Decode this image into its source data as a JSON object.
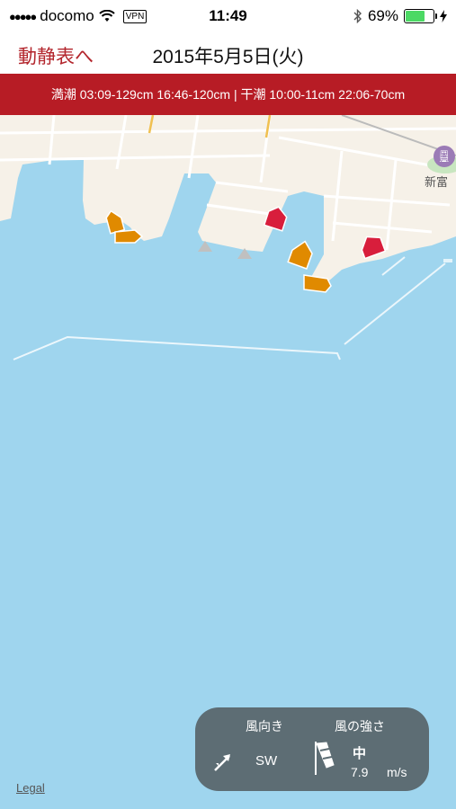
{
  "status_bar": {
    "signal_dots": "●●●●●",
    "carrier": "docomo",
    "wifi_icon": "wifi-icon",
    "vpn": "VPN",
    "time": "11:49",
    "bluetooth_icon": "bluetooth-icon",
    "battery_percent": "69%",
    "battery_level": 0.69,
    "charging_icon": "bolt-icon"
  },
  "nav": {
    "back_label": "動静表へ",
    "title": "2015年5月5日(火)"
  },
  "tide_banner": {
    "text": "満潮 03:09-129cm 16:46-120cm | 干潮 10:00-11cm 22:06-70cm"
  },
  "map": {
    "station_icon": "train-station-icon",
    "station_label": "新富",
    "legal_link": "Legal",
    "colors": {
      "water": "#9fd5ee",
      "land": "#f6f1e8",
      "ship_orange": "#e08a00",
      "ship_red": "#d81e3c"
    }
  },
  "wind": {
    "direction_header": "風向き",
    "strength_header": "風の強さ",
    "direction_icon": "wind-direction-arrow-icon",
    "direction_value": "SW",
    "windsock_icon": "windsock-icon",
    "strength_level": "中",
    "speed_value": "7.9",
    "speed_unit": "m/s"
  }
}
